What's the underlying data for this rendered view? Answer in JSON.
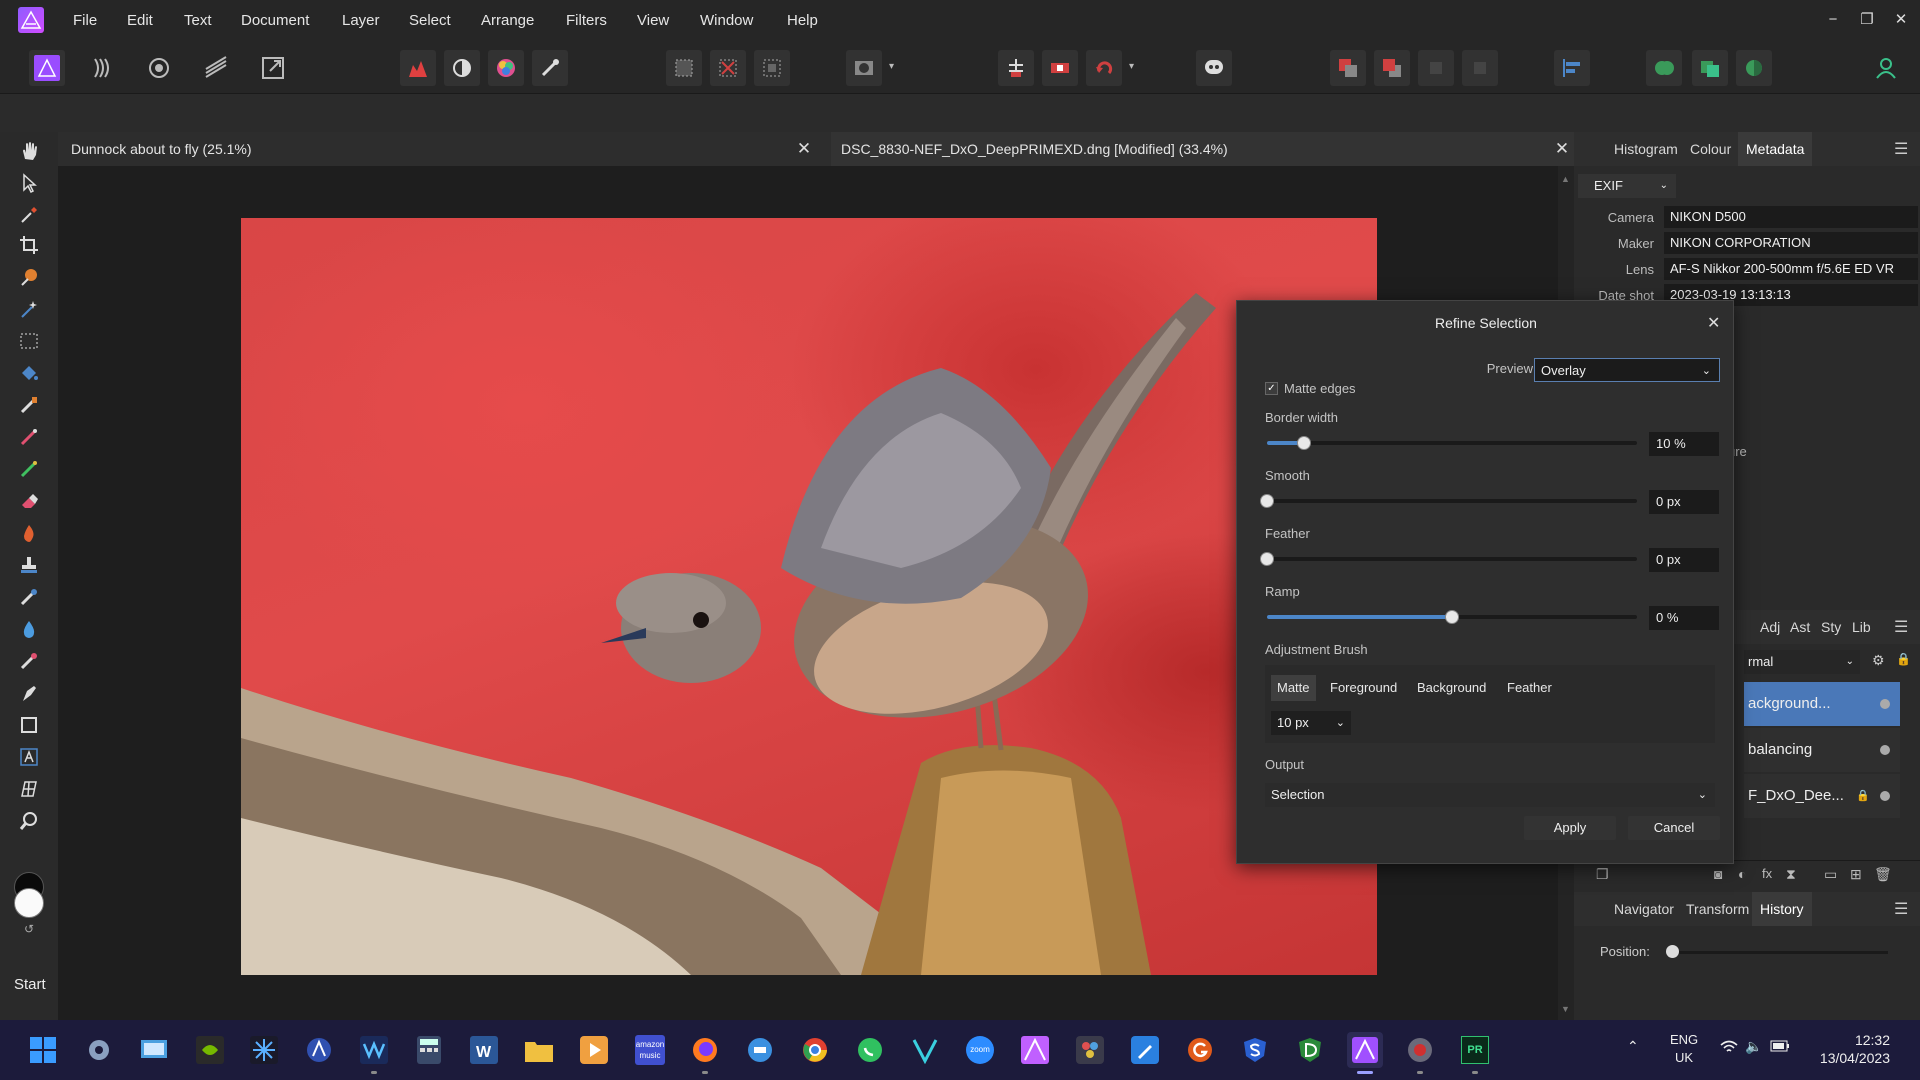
{
  "menubar": {
    "items": [
      "File",
      "Edit",
      "Text",
      "Document",
      "Layer",
      "Select",
      "Arrange",
      "Filters",
      "View",
      "Window",
      "Help"
    ],
    "window_controls": {
      "minimize": "−",
      "restore": "❐",
      "close": "✕"
    }
  },
  "doc_tabs": [
    {
      "title": "Dunnock about to fly (25.1%)",
      "close": "✕"
    },
    {
      "title": "DSC_8830-NEF_DxO_DeepPRIMEXD.dng [Modified] (33.4%)",
      "close": "✕"
    }
  ],
  "top_panel": {
    "tabs": [
      "Histogram",
      "Colour",
      "Metadata"
    ],
    "active_tab": "Metadata",
    "section": "EXIF",
    "fields": [
      {
        "label": "Camera",
        "value": "NIKON D500"
      },
      {
        "label": "Maker",
        "value": "NIKON CORPORATION"
      },
      {
        "label": "Lens",
        "value": "AF-S Nikkor 200-500mm f/5.6E ED VR"
      },
      {
        "label": "Date shot",
        "value": "2023-03-19 13:13:13"
      }
    ],
    "partial_text": "ure"
  },
  "layers_panel": {
    "tabs": [
      "Adj",
      "Ast",
      "Sty",
      "Lib"
    ],
    "blend_mode": "rmal",
    "layers": [
      {
        "name": "ackground...",
        "selected": true
      },
      {
        "name": "balancing",
        "selected": false
      },
      {
        "name": "F_DxO_Dee...",
        "selected": false,
        "locked": true
      }
    ]
  },
  "bottom_panel": {
    "tabs": [
      "Navigator",
      "Transform",
      "History"
    ],
    "active_tab": "History",
    "position_label": "Position:"
  },
  "tools_panel": {
    "start_label": "Start"
  },
  "dialog": {
    "title": "Refine Selection",
    "close": "✕",
    "preview_label": "Preview",
    "preview_value": "Overlay",
    "matte_edges_label": "Matte edges",
    "matte_edges_checked": true,
    "sliders": [
      {
        "label": "Border width",
        "value_text": "10 %",
        "fraction": 0.1
      },
      {
        "label": "Smooth",
        "value_text": "0 px",
        "fraction": 0.0
      },
      {
        "label": "Feather",
        "value_text": "0 px",
        "fraction": 0.0
      },
      {
        "label": "Ramp",
        "value_text": "0 %",
        "fraction": 0.5
      }
    ],
    "adjustment_brush_label": "Adjustment Brush",
    "brush_modes": [
      "Matte",
      "Foreground",
      "Background",
      "Feather"
    ],
    "active_brush_mode": "Matte",
    "brush_size": "10 px",
    "output_label": "Output",
    "output_value": "Selection",
    "apply": "Apply",
    "cancel": "Cancel"
  },
  "taskbar": {
    "language": "ENG",
    "region": "UK",
    "time": "12:32",
    "date": "13/04/2023",
    "apps": [
      "start-icon",
      "settings-icon",
      "control-panel-icon",
      "nvidia-icon",
      "davinci-icon",
      "affinity-icon",
      "waves-icon",
      "calculator-icon",
      "word-icon",
      "explorer-icon",
      "media-player-icon",
      "amazon-music-icon",
      "firefox-icon",
      "messenger-icon",
      "chrome-icon",
      "whatsapp-icon",
      "vectorworks-icon",
      "zoom-icon",
      "affinity-designer-icon",
      "davinci-resolve-icon",
      "pen-icon",
      "grammarly-icon",
      "s-app-icon",
      "dxo-icon",
      "affinity-photo-icon",
      "recorder-icon",
      "premiere-icon"
    ],
    "amazon_label": "amazon music",
    "zoom_label": "zoom",
    "premiere_label": "PR"
  },
  "colors": {
    "accent": "#4c86c8",
    "taskbar": "#1c1b3b",
    "selected_layer": "#4a78b8"
  }
}
